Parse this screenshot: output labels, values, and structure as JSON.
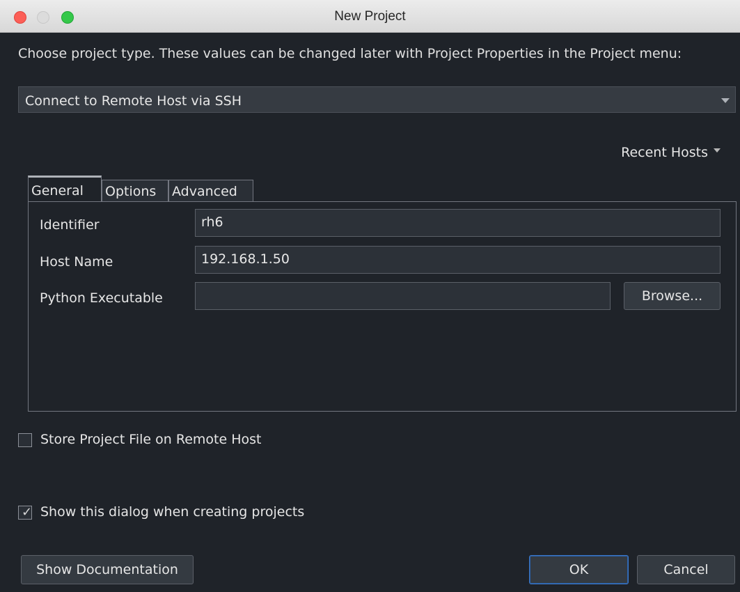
{
  "window": {
    "title": "New Project"
  },
  "description": "Choose project type.  These values can be changed later with Project Properties in the Project menu:",
  "project_type": {
    "selected": "Connect to Remote Host via SSH"
  },
  "recent_hosts_label": "Recent Hosts",
  "tabs": [
    {
      "label": "General",
      "active": true
    },
    {
      "label": "Options",
      "active": false
    },
    {
      "label": "Advanced",
      "active": false
    }
  ],
  "general": {
    "identifier_label": "Identifier",
    "identifier_value": "rh6",
    "host_name_label": "Host Name",
    "host_name_value": "192.168.1.50",
    "python_executable_label": "Python Executable",
    "python_executable_value": "",
    "browse_label": "Browse..."
  },
  "options": {
    "store_remote_label": "Store Project File on Remote Host",
    "store_remote_checked": false,
    "show_dialog_label": "Show this dialog when creating projects",
    "show_dialog_checked": true
  },
  "buttons": {
    "documentation": "Show Documentation",
    "ok": "OK",
    "cancel": "Cancel"
  },
  "colors": {
    "background": "#1f2329",
    "field_bg": "#2c3138",
    "default_button_border": "#3d77c5"
  }
}
